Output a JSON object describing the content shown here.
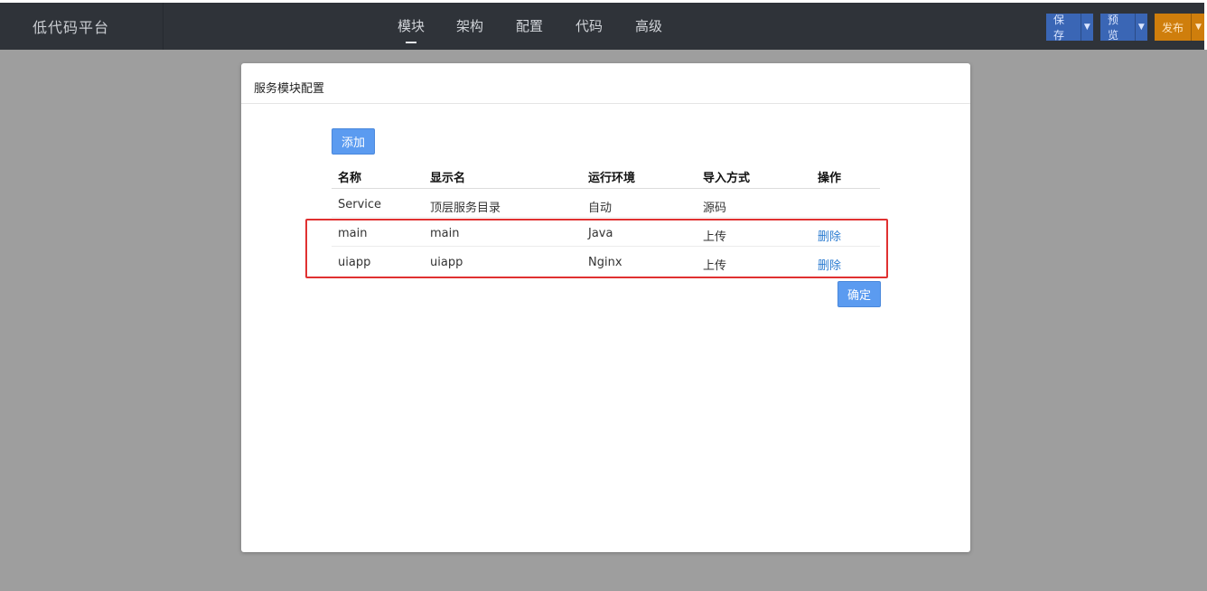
{
  "app": {
    "title": "低代码平台"
  },
  "nav": {
    "items": [
      "模块",
      "架构",
      "配置",
      "代码",
      "高级"
    ],
    "active": "模块"
  },
  "toolbar": {
    "save_label": "保存",
    "preview_label": "预览",
    "publish_label": "发布"
  },
  "panel": {
    "title": "服务模块配置",
    "add_label": "添加",
    "confirm_label": "确定",
    "columns": [
      "名称",
      "显示名",
      "运行环境",
      "导入方式",
      "操作"
    ],
    "rows": [
      {
        "name": "Service",
        "display": "顶层服务目录",
        "runtime": "自动",
        "import": "源码",
        "action": ""
      },
      {
        "name": "main",
        "display": "main",
        "runtime": "Java",
        "import": "上传",
        "action": "删除"
      },
      {
        "name": "uiapp",
        "display": "uiapp",
        "runtime": "Nginx",
        "import": "上传",
        "action": "删除"
      }
    ]
  },
  "colors": {
    "accent": "#5b9bf0",
    "highlight": "#e03131",
    "publish": "#cf7e0c",
    "topbar": "#2f3339"
  },
  "icons": {
    "caret": "caret-down-icon"
  }
}
